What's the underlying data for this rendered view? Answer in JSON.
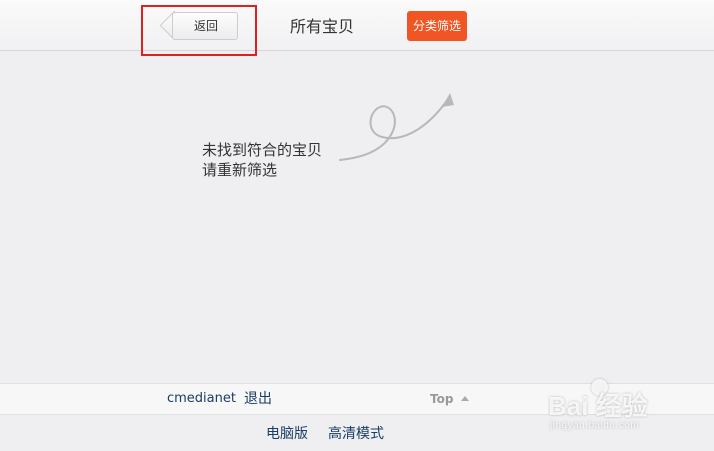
{
  "header": {
    "back_label": "返回",
    "title": "所有宝贝",
    "filter_label": "分类筛选"
  },
  "empty_state": {
    "line1": "未找到符合的宝贝",
    "line2": "请重新筛选"
  },
  "footer": {
    "username": "cmedianet",
    "logout_label": "退出",
    "top_label": "Top",
    "desktop_label": "电脑版",
    "hd_label": "高清模式"
  },
  "watermark": {
    "logo_text": "Bai 经验",
    "url": "jingyan.baidu.com"
  },
  "colors": {
    "accent": "#f05523",
    "highlight": "#e02020",
    "link": "#1a3d66"
  }
}
